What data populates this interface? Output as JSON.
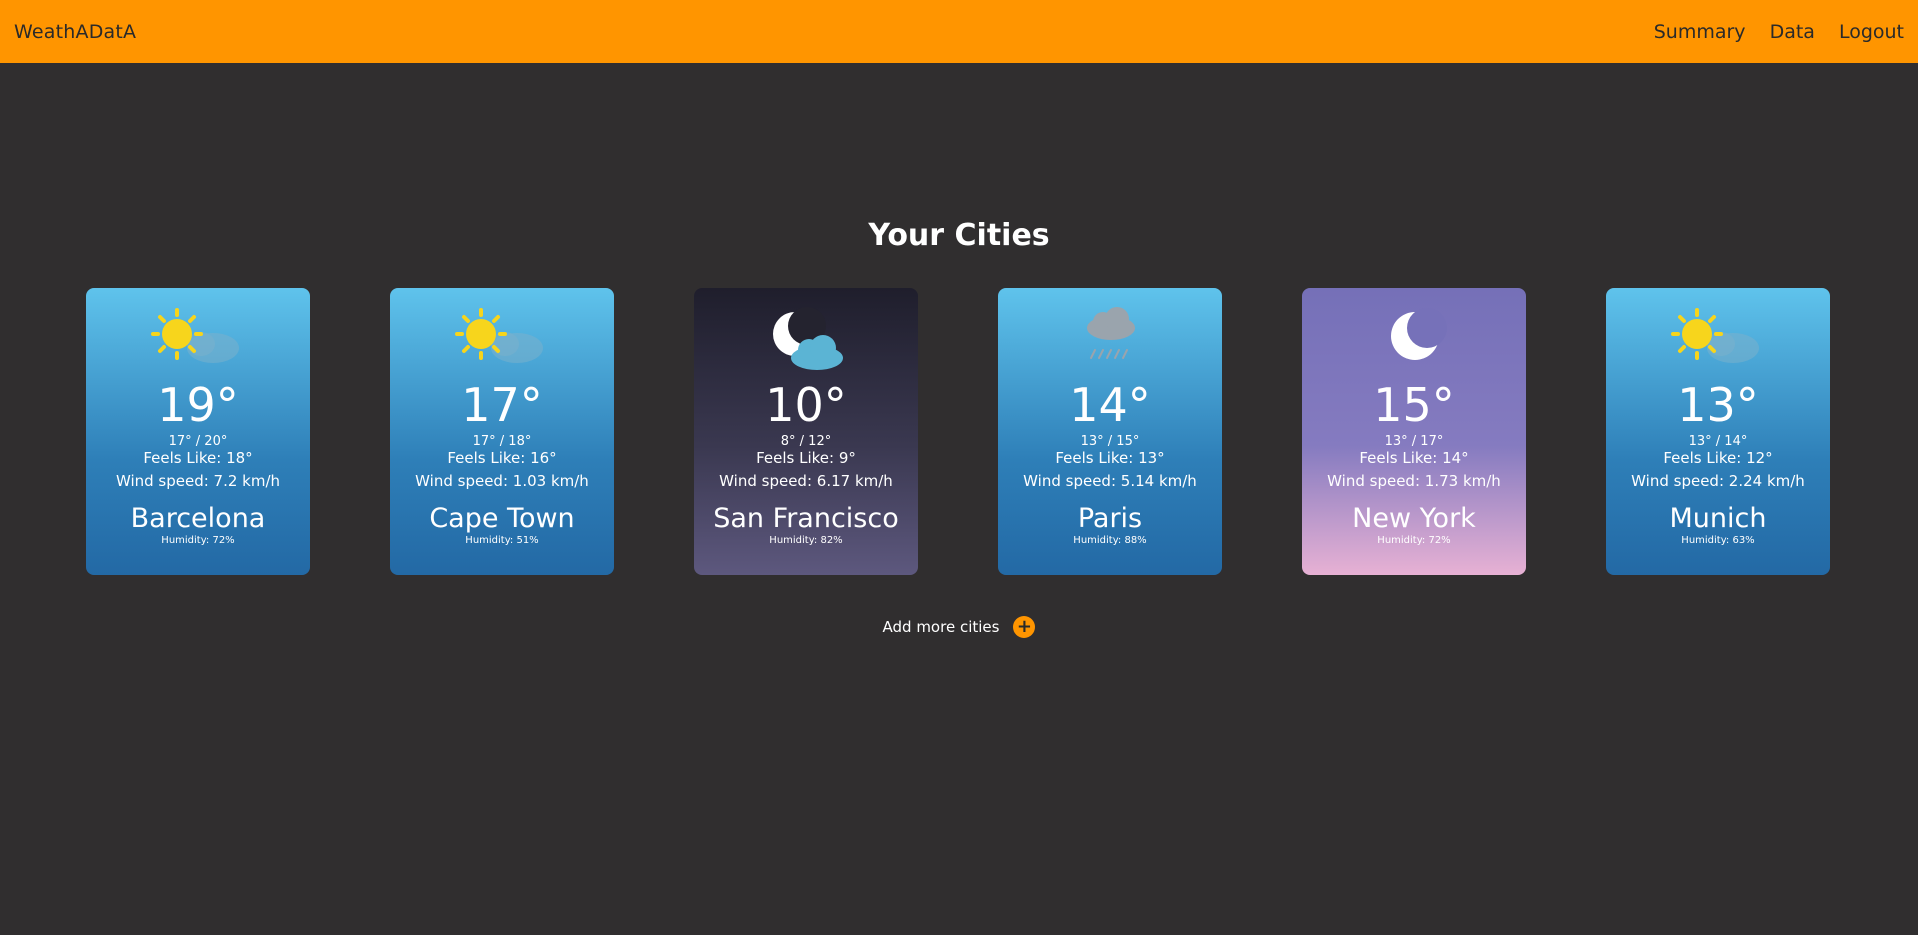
{
  "navbar": {
    "brand": "WeathADatA",
    "links": [
      "Summary",
      "Data",
      "Logout"
    ]
  },
  "page": {
    "title": "Your Cities",
    "add_more_label": "Add more cities",
    "add_icon": "+"
  },
  "cities": [
    {
      "temp": "19°",
      "range": "17° / 20°",
      "feels": "Feels Like: 18°",
      "wind": "Wind speed: 7.2 km/h",
      "name": "Barcelona",
      "humidity": "Humidity: 72%",
      "condition_icon": "sun-cloud-icon"
    },
    {
      "temp": "17°",
      "range": "17° / 18°",
      "feels": "Feels Like: 16°",
      "wind": "Wind speed: 1.03 km/h",
      "name": "Cape Town",
      "humidity": "Humidity: 51%",
      "condition_icon": "sun-cloud-icon"
    },
    {
      "temp": "10°",
      "range": "8° / 12°",
      "feels": "Feels Like: 9°",
      "wind": "Wind speed: 6.17 km/h",
      "name": "San Francisco",
      "humidity": "Humidity: 82%",
      "condition_icon": "moon-cloud-icon"
    },
    {
      "temp": "14°",
      "range": "13° / 15°",
      "feels": "Feels Like: 13°",
      "wind": "Wind speed: 5.14 km/h",
      "name": "Paris",
      "humidity": "Humidity: 88%",
      "condition_icon": "rain-cloud-icon"
    },
    {
      "temp": "15°",
      "range": "13° / 17°",
      "feels": "Feels Like: 14°",
      "wind": "Wind speed: 1.73 km/h",
      "name": "New York",
      "humidity": "Humidity: 72%",
      "condition_icon": "moon-icon"
    },
    {
      "temp": "13°",
      "range": "13° / 14°",
      "feels": "Feels Like: 12°",
      "wind": "Wind speed: 2.24 km/h",
      "name": "Munich",
      "humidity": "Humidity: 63%",
      "condition_icon": "sun-cloud-icon"
    }
  ],
  "colors": {
    "navbar": "#ff9500",
    "background": "#302e2f",
    "accent": "#ff9500"
  }
}
